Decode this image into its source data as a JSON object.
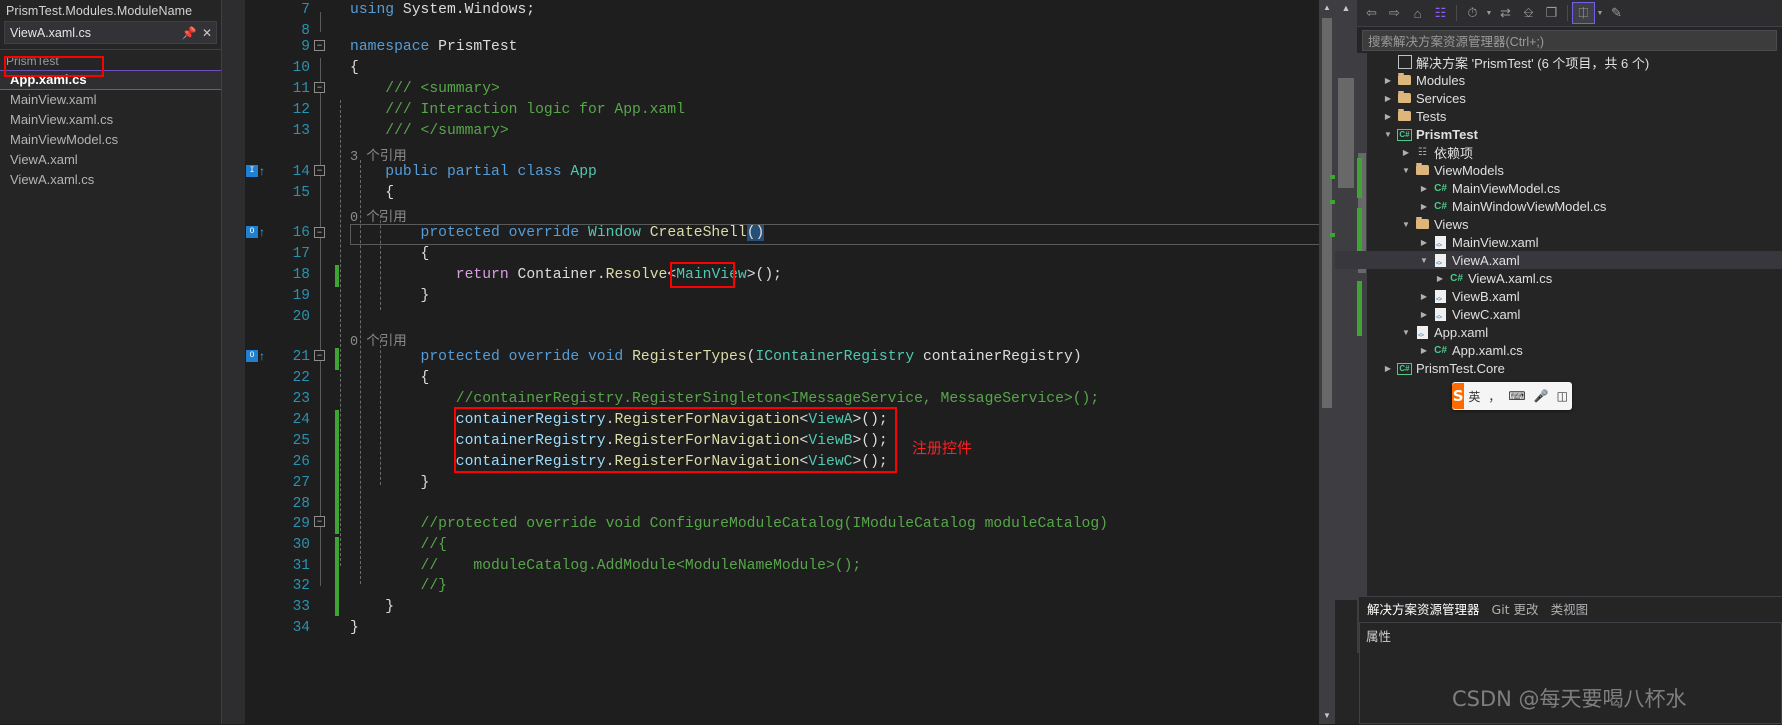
{
  "left_panel": {
    "title": "PrismTest.Modules.ModuleName",
    "combo_value": "ViewA.xaml.cs",
    "combo_icons": [
      "pin-icon",
      "close-icon"
    ],
    "group_label": "PrismTest",
    "items": [
      {
        "label": "App.xaml.cs",
        "selected": true
      },
      {
        "label": "MainView.xaml",
        "selected": false
      },
      {
        "label": "MainView.xaml.cs",
        "selected": false
      },
      {
        "label": "MainViewModel.cs",
        "selected": false
      },
      {
        "label": "ViewA.xaml",
        "selected": false
      },
      {
        "label": "ViewA.xaml.cs",
        "selected": false
      }
    ]
  },
  "editor": {
    "lines": [
      {
        "num": "7",
        "text": "using System.Windows;"
      },
      {
        "num": "8",
        "text": ""
      },
      {
        "num": "9",
        "text": "namespace PrismTest"
      },
      {
        "num": "10",
        "text": "{"
      },
      {
        "num": "11",
        "text": "    /// <summary>"
      },
      {
        "num": "12",
        "text": "    /// Interaction logic for App.xaml"
      },
      {
        "num": "13",
        "text": "    /// </summary>"
      },
      {
        "num": "14",
        "text": "    public partial class App"
      },
      {
        "num": "15",
        "text": "    {"
      },
      {
        "num": "16",
        "text": "        protected override Window CreateShell()"
      },
      {
        "num": "17",
        "text": "        {"
      },
      {
        "num": "18",
        "text": "            return Container.Resolve<MainView>();"
      },
      {
        "num": "19",
        "text": "        }"
      },
      {
        "num": "20",
        "text": ""
      },
      {
        "num": "21",
        "text": "        protected override void RegisterTypes(IContainerRegistry containerRegistry)"
      },
      {
        "num": "22",
        "text": "        {"
      },
      {
        "num": "23",
        "text": "            //containerRegistry.RegisterSingleton<IMessageService, MessageService>();"
      },
      {
        "num": "24",
        "text": "            containerRegistry.RegisterForNavigation<ViewA>();"
      },
      {
        "num": "25",
        "text": "            containerRegistry.RegisterForNavigation<ViewB>();"
      },
      {
        "num": "26",
        "text": "            containerRegistry.RegisterForNavigation<ViewC>();"
      },
      {
        "num": "27",
        "text": "        }"
      },
      {
        "num": "28",
        "text": ""
      },
      {
        "num": "29",
        "text": "        //protected override void ConfigureModuleCatalog(IModuleCatalog moduleCatalog)"
      },
      {
        "num": "30",
        "text": "        //{"
      },
      {
        "num": "31",
        "text": "        //    moduleCatalog.AddModule<ModuleNameModule>();"
      },
      {
        "num": "32",
        "text": "        //}"
      },
      {
        "num": "33",
        "text": "    }"
      },
      {
        "num": "34",
        "text": "}"
      }
    ],
    "codelens": [
      {
        "line": "13",
        "text": "3 个引用"
      },
      {
        "line": "15",
        "text": "0 个引用"
      },
      {
        "line": "20",
        "text": "0 个引用"
      }
    ],
    "annotation": "注册控件",
    "annotation_color": "#ff2020"
  },
  "right_panel": {
    "toolbar_icons": [
      "back-arrow-icon",
      "forward-arrow-icon",
      "home-icon",
      "sync-with-active-document-icon",
      "pending-changes-filter-icon",
      "chevron-down-icon",
      "refresh-icon",
      "collapse-all-icon",
      "show-all-files-icon",
      "properties-icon",
      "chevron-down-icon",
      "preview-icon"
    ],
    "search_placeholder": "搜索解决方案资源管理器(Ctrl+;)",
    "tree": [
      {
        "depth": 0,
        "twist": "collapsed",
        "icon": "solution-icon",
        "label": "解决方案 'PrismTest' (6 个项目，共 6 个)",
        "bold": false,
        "selected": false,
        "no_twist": true
      },
      {
        "depth": 1,
        "twist": "collapsed",
        "icon": "folder-icon",
        "label": "Modules",
        "bold": false,
        "selected": false
      },
      {
        "depth": 1,
        "twist": "collapsed",
        "icon": "folder-icon",
        "label": "Services",
        "bold": false,
        "selected": false
      },
      {
        "depth": 1,
        "twist": "collapsed",
        "icon": "folder-icon",
        "label": "Tests",
        "bold": false,
        "selected": false
      },
      {
        "depth": 1,
        "twist": "expanded",
        "icon": "csproj-icon",
        "label": "PrismTest",
        "bold": true,
        "selected": false
      },
      {
        "depth": 2,
        "twist": "collapsed",
        "icon": "dependencies-icon",
        "label": "依赖项",
        "bold": false,
        "selected": false
      },
      {
        "depth": 2,
        "twist": "expanded",
        "icon": "folder-icon",
        "label": "ViewModels",
        "bold": false,
        "selected": false
      },
      {
        "depth": 3,
        "twist": "collapsed",
        "icon": "cs-icon",
        "label": "MainViewModel.cs",
        "bold": false,
        "selected": false
      },
      {
        "depth": 3,
        "twist": "collapsed",
        "icon": "cs-icon",
        "label": "MainWindowViewModel.cs",
        "bold": false,
        "selected": false
      },
      {
        "depth": 2,
        "twist": "expanded",
        "icon": "folder-icon",
        "label": "Views",
        "bold": false,
        "selected": false
      },
      {
        "depth": 3,
        "twist": "collapsed",
        "icon": "xaml-icon",
        "label": "MainView.xaml",
        "bold": false,
        "selected": false
      },
      {
        "depth": 3,
        "twist": "expanded",
        "icon": "xaml-icon",
        "label": "ViewA.xaml",
        "bold": false,
        "selected": true
      },
      {
        "depth": 4,
        "twist": "collapsed",
        "icon": "cs-icon",
        "label": "ViewA.xaml.cs",
        "bold": false,
        "selected": false
      },
      {
        "depth": 3,
        "twist": "collapsed",
        "icon": "xaml-icon",
        "label": "ViewB.xaml",
        "bold": false,
        "selected": false
      },
      {
        "depth": 3,
        "twist": "collapsed",
        "icon": "xaml-icon",
        "label": "ViewC.xaml",
        "bold": false,
        "selected": false
      },
      {
        "depth": 2,
        "twist": "expanded",
        "icon": "xaml-icon",
        "label": "App.xaml",
        "bold": false,
        "selected": false
      },
      {
        "depth": 3,
        "twist": "collapsed",
        "icon": "cs-icon",
        "label": "App.xaml.cs",
        "bold": false,
        "selected": false
      },
      {
        "depth": 1,
        "twist": "collapsed",
        "icon": "csproj-icon",
        "label": "PrismTest.Core",
        "bold": false,
        "selected": false
      }
    ]
  },
  "dock": {
    "tabs": [
      {
        "label": "解决方案资源管理器",
        "selected": true
      },
      {
        "label": "Git 更改",
        "selected": false
      },
      {
        "label": "类视图",
        "selected": false
      }
    ],
    "properties_title": "属性"
  },
  "ime": {
    "logo": "S",
    "mode": "英",
    "icons": [
      "comma-period-icon",
      "keyboard-toggle-icon",
      "mic-icon",
      "panel-icon"
    ]
  },
  "watermark": "CSDN @每天要喝八杯水"
}
